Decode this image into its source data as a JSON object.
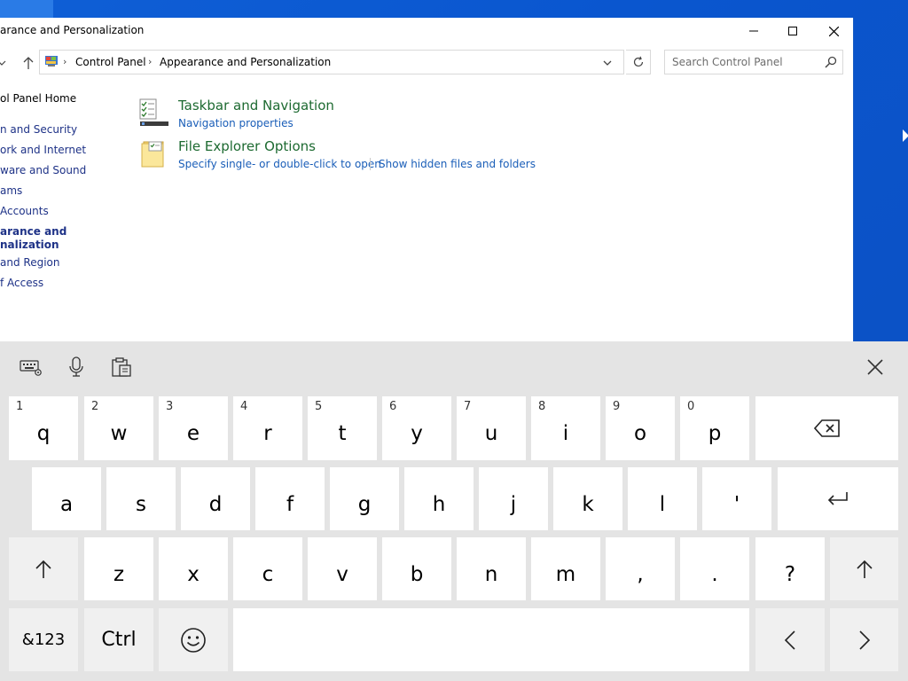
{
  "window": {
    "title": "arance and Personalization",
    "address": {
      "crumbs": [
        "Control Panel",
        "Appearance and Personalization"
      ]
    },
    "search": {
      "placeholder": "Search Control Panel"
    }
  },
  "leftnav": {
    "home": "ol Panel Home",
    "categories": [
      "n and Security",
      "ork and Internet",
      "ware and Sound",
      "ams",
      "Accounts",
      "arance and",
      "nalization",
      "and Region",
      "f Access"
    ]
  },
  "content": {
    "items": [
      {
        "title": "Taskbar and Navigation",
        "links": [
          "Navigation properties"
        ],
        "icon": "taskbar-icon"
      },
      {
        "title": "File Explorer Options",
        "links": [
          "Specify single- or double-click to open",
          "Show hidden files and folders"
        ],
        "icon": "folder-options-icon"
      }
    ]
  },
  "keyboard": {
    "row1": [
      {
        "hint": "1",
        "label": "q"
      },
      {
        "hint": "2",
        "label": "w"
      },
      {
        "hint": "3",
        "label": "e"
      },
      {
        "hint": "4",
        "label": "r"
      },
      {
        "hint": "5",
        "label": "t"
      },
      {
        "hint": "6",
        "label": "y"
      },
      {
        "hint": "7",
        "label": "u"
      },
      {
        "hint": "8",
        "label": "i"
      },
      {
        "hint": "9",
        "label": "o"
      },
      {
        "hint": "0",
        "label": "p"
      }
    ],
    "row2": [
      "a",
      "s",
      "d",
      "f",
      "g",
      "h",
      "j",
      "k",
      "l",
      "'"
    ],
    "row3": [
      "z",
      "x",
      "c",
      "v",
      "b",
      "n",
      "m",
      ",",
      ".",
      "?"
    ],
    "symbols_label": "&123",
    "ctrl_label": "Ctrl"
  },
  "colors": {
    "desktop": "#0a56cf",
    "link": "#1a5eb8",
    "heading": "#1d6a31",
    "keyboard_bg": "#e4e4e4"
  }
}
